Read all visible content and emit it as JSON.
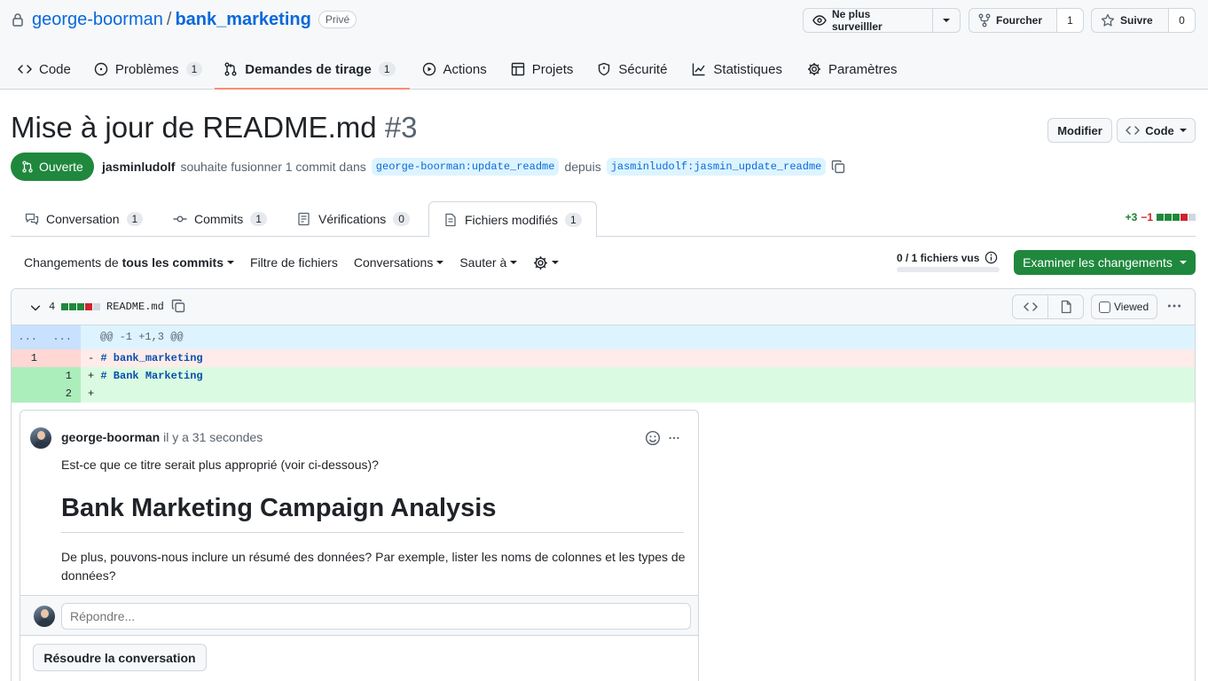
{
  "repo": {
    "owner": "george-boorman",
    "separator": "/",
    "name": "bank_marketing",
    "visibility": "Privé"
  },
  "header_actions": {
    "watch_label": "Ne plus surveilller",
    "fork_label": "Fourcher",
    "fork_count": "1",
    "star_label": "Suivre",
    "star_count": "0"
  },
  "nav": {
    "items": [
      {
        "label": "Code",
        "icon": "code-icon"
      },
      {
        "label": "Problèmes",
        "icon": "issue-icon",
        "count": "1"
      },
      {
        "label": "Demandes de tirage",
        "icon": "pull-request-icon",
        "count": "1",
        "active": true
      },
      {
        "label": "Actions",
        "icon": "play-icon"
      },
      {
        "label": "Projets",
        "icon": "table-icon"
      },
      {
        "label": "Sécurité",
        "icon": "shield-icon"
      },
      {
        "label": "Statistiques",
        "icon": "graph-icon"
      },
      {
        "label": "Paramètres",
        "icon": "gear-icon"
      }
    ]
  },
  "pr": {
    "title": "Mise à jour de README.md",
    "number": "#3",
    "edit_label": "Modifier",
    "code_label": "Code",
    "state": "Ouverte",
    "author": "jasminludolf",
    "merge_text": "souhaite fusionner 1 commit dans",
    "base_branch": "george-boorman:update_readme",
    "from_text": "depuis",
    "head_branch": "jasminludolf:jasmin_update_readme"
  },
  "tabs": [
    {
      "label": "Conversation",
      "count": "1",
      "icon": "comment-discussion-icon"
    },
    {
      "label": "Commits",
      "count": "1",
      "icon": "commit-icon"
    },
    {
      "label": "Vérifications",
      "count": "0",
      "icon": "checklist-icon"
    },
    {
      "label": "Fichiers modifiés",
      "count": "1",
      "icon": "file-diff-icon",
      "active": true
    }
  ],
  "diffstat": {
    "additions": "+3",
    "deletions": "−1"
  },
  "toolbar": {
    "changes_prefix": "Changements de",
    "changes_bold": "tous les commits",
    "file_filter": "Filtre de fichiers",
    "conversations": "Conversations",
    "jump_to": "Sauter à",
    "files_viewed": "0 / 1 fichiers vus",
    "files_viewed_fraction": 0,
    "review_label": "Examiner les changements"
  },
  "file": {
    "change_count": "4",
    "filename": "README.md",
    "viewed_label": "Viewed",
    "diff": [
      {
        "type": "hunk",
        "old": "...",
        "new": "...",
        "text": "@@ -1 +1,3 @@"
      },
      {
        "type": "del",
        "old": "1",
        "new": "",
        "marker": "-",
        "text": "# bank_marketing"
      },
      {
        "type": "add",
        "old": "",
        "new": "1",
        "marker": "+",
        "text": "# Bank Marketing"
      },
      {
        "type": "add",
        "old": "",
        "new": "2",
        "marker": "+",
        "text": ""
      }
    ]
  },
  "comment": {
    "author": "george-boorman",
    "time": "il y a 31 secondes",
    "body1": "Est-ce que ce titre serait plus approprié (voir ci-dessous)?",
    "heading": "Bank Marketing Campaign Analysis",
    "body2": "De plus, pouvons-nous inclure un résumé des données? Par exemple, lister les noms de colonnes et les types de données?",
    "reply_placeholder": "Répondre...",
    "resolve_label": "Résoudre la conversation"
  },
  "colors": {
    "accent": "#0969da",
    "open_green": "#1f883d",
    "tab_underline": "#fd8c73",
    "addition": "#1a7f37",
    "deletion": "#cf222e"
  }
}
